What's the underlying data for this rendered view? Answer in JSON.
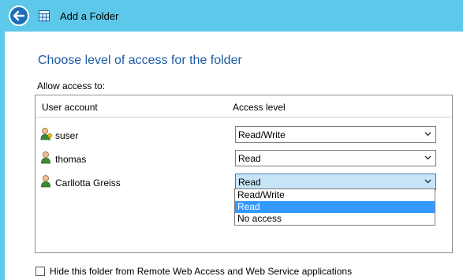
{
  "window": {
    "title": "Add a Folder"
  },
  "page": {
    "heading": "Choose level of access for the folder",
    "allow_label": "Allow access to:"
  },
  "grid": {
    "columns": [
      "User account",
      "Access level"
    ],
    "rows": [
      {
        "user": "suser",
        "icon": "admin-user-icon",
        "access": "Read/Write"
      },
      {
        "user": "thomas",
        "icon": "user-icon",
        "access": "Read"
      },
      {
        "user": "Carllotta Greiss",
        "icon": "user-icon",
        "access": "Read"
      }
    ]
  },
  "dropdown": {
    "options": [
      "Read/Write",
      "Read",
      "No access"
    ],
    "selected": "Read"
  },
  "hide_option": {
    "label": "Hide this folder from Remote Web Access and Web Service applications",
    "checked": false
  },
  "colors": {
    "titlebar": "#5ec8ea",
    "heading": "#1b5aa6",
    "back_button": "#1b6fb8",
    "selection": "#3399ff"
  }
}
